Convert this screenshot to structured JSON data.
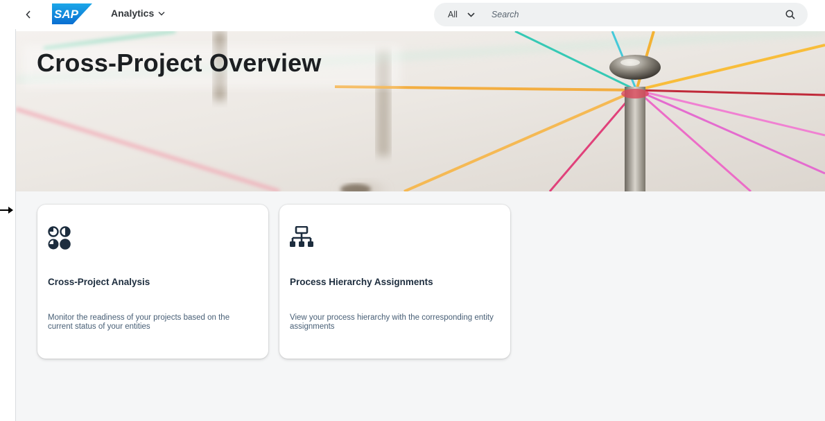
{
  "shell": {
    "back_label": "<",
    "logo_text": "SAP",
    "app_title": "Analytics",
    "search": {
      "scope": "All",
      "placeholder": "Search"
    },
    "icons": {
      "back": "chevron-left-icon",
      "app_menu": "chevron-down-icon",
      "scope": "chevron-down-icon",
      "search": "search-icon"
    }
  },
  "page": {
    "title": "Cross-Project Overview"
  },
  "cards": [
    {
      "title": "Cross-Project Analysis",
      "description": "Monitor the readiness of your projects based on the current status of your entities",
      "icon": "status-circles-icon"
    },
    {
      "title": "Process Hierarchy Assignments",
      "description": "View your process hierarchy with the corresponding entity assignments",
      "icon": "hierarchy-icon"
    }
  ],
  "colors": {
    "brand": "#0a6ed1",
    "title_text": "#1c1f22",
    "content_bg": "#f5f6f7",
    "search_bg": "#eff1f2"
  }
}
